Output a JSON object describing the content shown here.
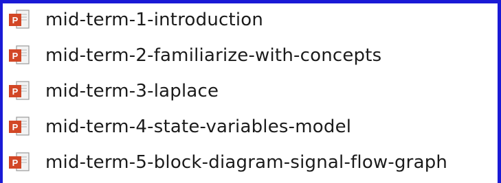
{
  "files": [
    {
      "name": "mid-term-1-introduction",
      "icon": "powerpoint-file-icon"
    },
    {
      "name": "mid-term-2-familiarize-with-concepts",
      "icon": "powerpoint-file-icon"
    },
    {
      "name": "mid-term-3-laplace",
      "icon": "powerpoint-file-icon"
    },
    {
      "name": "mid-term-4-state-variables-model",
      "icon": "powerpoint-file-icon"
    },
    {
      "name": "mid-term-5-block-diagram-signal-flow-graph",
      "icon": "powerpoint-file-icon"
    }
  ],
  "colors": {
    "frame": "#1a1ad6",
    "ppt_red": "#d24726",
    "text": "#1b1b1b"
  }
}
